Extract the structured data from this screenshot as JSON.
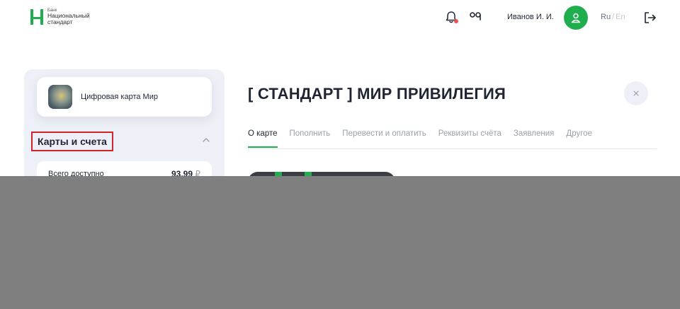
{
  "header": {
    "logo": {
      "small": "Банк",
      "line1": "Национальный",
      "line2": "стандарт"
    },
    "user_name": "Иванов И. И.",
    "lang_ru": "Ru",
    "lang_sep": "/",
    "lang_en": "En",
    "icons": {
      "notifications": "bell-icon",
      "key": "key-icon",
      "profile": "user-icon",
      "logout": "logout-icon"
    }
  },
  "sidebar": {
    "card_label": "Цифровая карта Мир",
    "section_title": "Карты и счета",
    "available_label": "Всего доступно",
    "available_value": "93,99",
    "available_currency": "₽"
  },
  "main": {
    "title": "[ СТАНДАРТ ] МИР ПРИВИЛЕГИЯ",
    "tabs": [
      {
        "label": "О карте",
        "active": true
      },
      {
        "label": "Пополнить",
        "active": false
      },
      {
        "label": "Перевести и оплатить",
        "active": false
      },
      {
        "label": "Реквизиты счёта",
        "active": false
      },
      {
        "label": "Заявления",
        "active": false
      },
      {
        "label": "Другое",
        "active": false
      }
    ]
  },
  "colors": {
    "brand_green": "#1fae4d",
    "alert_red": "#f0524f",
    "highlight_red": "#d2232a",
    "overlay_gray": "#7f7f7f"
  }
}
